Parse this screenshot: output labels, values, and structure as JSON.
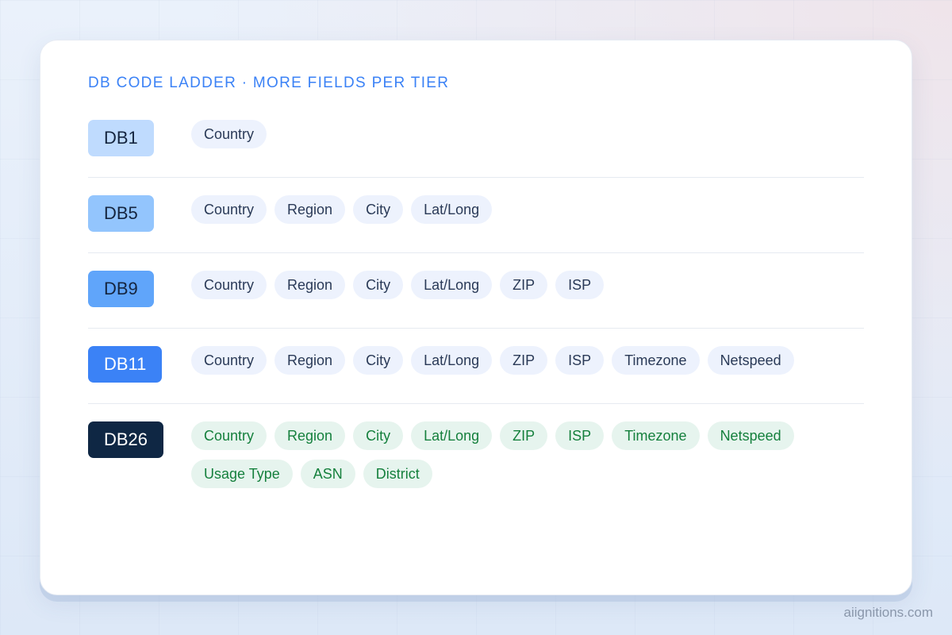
{
  "heading": "DB CODE LADDER · MORE FIELDS PER TIER",
  "colors": {
    "heading": "#3b82f6",
    "chip_default_bg": "#edf2fd",
    "chip_default_text": "#2a3a57",
    "chip_green_bg": "#e6f4ee",
    "chip_green_text": "#15803d"
  },
  "tiers": [
    {
      "code": "DB1",
      "badge_bg": "#bfdbfe",
      "badge_text": "#15253f",
      "chip_style": "default",
      "fields": [
        "Country"
      ]
    },
    {
      "code": "DB5",
      "badge_bg": "#93c5fd",
      "badge_text": "#15253f",
      "chip_style": "default",
      "fields": [
        "Country",
        "Region",
        "City",
        "Lat/Long"
      ]
    },
    {
      "code": "DB9",
      "badge_bg": "#60a5fa",
      "badge_text": "#15253f",
      "chip_style": "default",
      "fields": [
        "Country",
        "Region",
        "City",
        "Lat/Long",
        "ZIP",
        "ISP"
      ]
    },
    {
      "code": "DB11",
      "badge_bg": "#3b82f6",
      "badge_text": "#ffffff",
      "chip_style": "default",
      "fields": [
        "Country",
        "Region",
        "City",
        "Lat/Long",
        "ZIP",
        "ISP",
        "Timezone",
        "Netspeed"
      ]
    },
    {
      "code": "DB26",
      "badge_bg": "#0f2744",
      "badge_text": "#ffffff",
      "chip_style": "green",
      "fields": [
        "Country",
        "Region",
        "City",
        "Lat/Long",
        "ZIP",
        "ISP",
        "Timezone",
        "Netspeed",
        "Usage Type",
        "ASN",
        "District"
      ]
    }
  ],
  "watermark": "aiignitions.com"
}
